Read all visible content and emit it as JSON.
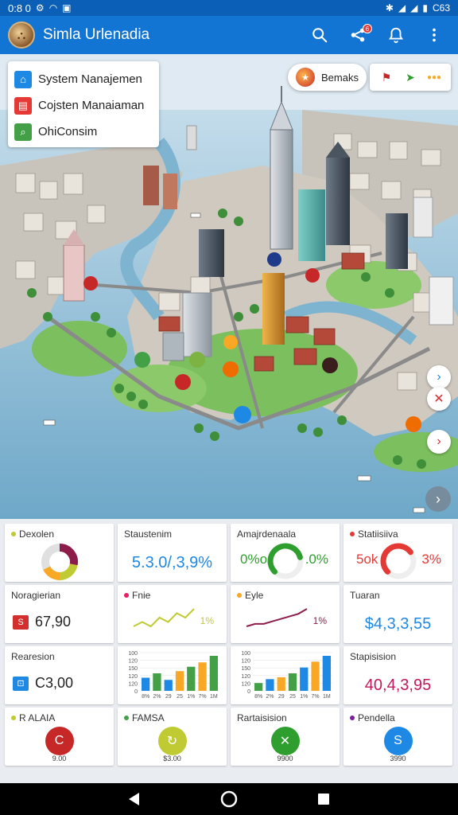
{
  "status_bar": {
    "time": "0:8 0"
  },
  "app_bar": {
    "title": "Simla Urlenadia",
    "notification_count": "6"
  },
  "map": {
    "layers": [
      {
        "label": "System Nanajemen",
        "icon": "house-icon",
        "color": "#1e88e5"
      },
      {
        "label": "Cojsten Manaiaman",
        "icon": "document-icon",
        "color": "#e53935"
      },
      {
        "label": "OhiConsim",
        "icon": "search-icon",
        "color": "#43a047"
      }
    ],
    "chip": {
      "label": "Bemaks"
    }
  },
  "stats": {
    "row1": [
      {
        "title": "Dexolen",
        "type": "donut",
        "dot_color": "#c0ca33",
        "segments": [
          28,
          22,
          18,
          32
        ],
        "colors": [
          "#8e1c4a",
          "#c0ca33",
          "#f9a825",
          "#e0e0e0"
        ]
      },
      {
        "title": "Staustenim",
        "value": "5.3.0/,3,9%",
        "color": "#1e88e5"
      },
      {
        "title": "Amajrdenaala",
        "value_left": "0%o,",
        "value_right": ".0%",
        "color": "#2e9e2e",
        "gauge": 0.78
      },
      {
        "title": "Statiisiiva",
        "dot_color": "#e53935",
        "value_left": "5ok",
        "value_right": "3%",
        "color": "#e53935",
        "gauge": 0.7
      }
    ],
    "row2": [
      {
        "title": "Noragierian",
        "value": "67,90",
        "icon_color": "#d32f2f"
      },
      {
        "title": "Fnie",
        "dot_color": "#e91e63",
        "value": "1%",
        "line_color": "#c0ca33",
        "trend": [
          5,
          6,
          5,
          7,
          6,
          8,
          7,
          9
        ]
      },
      {
        "title": "Eyle",
        "dot_color": "#f9a825",
        "value": "1%",
        "line_color": "#8e1c4a",
        "trend": [
          3,
          4,
          4,
          5,
          6,
          7,
          8,
          10
        ]
      },
      {
        "title": "Tuaran",
        "value": "$4,3,3,55",
        "color": "#1e88e5"
      }
    ],
    "row3": [
      {
        "title": "Rearesion",
        "value": "C3,00",
        "icon_color": "#1e88e5"
      },
      {
        "title": "",
        "type": "bars",
        "y_ticks": [
          "100",
          "120",
          "150",
          "120",
          "120",
          "0"
        ],
        "x_ticks": [
          "8%",
          "2%",
          "29",
          "25",
          "1%",
          "7%",
          "1M"
        ],
        "bars": [
          12,
          16,
          10,
          18,
          22,
          26,
          32
        ],
        "colors": [
          "#1e88e5",
          "#43a047",
          "#1e88e5",
          "#f9a825",
          "#43a047",
          "#f9a825",
          "#43a047"
        ]
      },
      {
        "title": "",
        "type": "bars",
        "y_ticks": [
          "100",
          "120",
          "150",
          "120",
          "120",
          "0"
        ],
        "x_ticks": [
          "8%",
          "2%",
          "29",
          "25",
          "1%",
          "7%",
          "1M"
        ],
        "bars": [
          8,
          12,
          14,
          18,
          24,
          30,
          36
        ],
        "colors": [
          "#43a047",
          "#1e88e5",
          "#f9a825",
          "#43a047",
          "#1e88e5",
          "#f9a825",
          "#1e88e5"
        ]
      },
      {
        "title": "Stapisision",
        "value": "40,4,3,95",
        "color": "#c2185b"
      }
    ],
    "row4": [
      {
        "title": "R ALAIA",
        "dot_color": "#c0ca33",
        "color": "#c62828",
        "icon": "c",
        "caption": "9.00"
      },
      {
        "title": "FAMSA",
        "dot_color": "#43a047",
        "color": "#c0ca33",
        "icon": "refresh",
        "caption": "$3.00"
      },
      {
        "title": "Rartaisision",
        "color": "#2e9e2e",
        "icon": "x",
        "caption": "9900"
      },
      {
        "title": "Pendella",
        "dot_color": "#7b1fa2",
        "color": "#1e88e5",
        "icon": "s",
        "caption": "3990"
      }
    ]
  }
}
